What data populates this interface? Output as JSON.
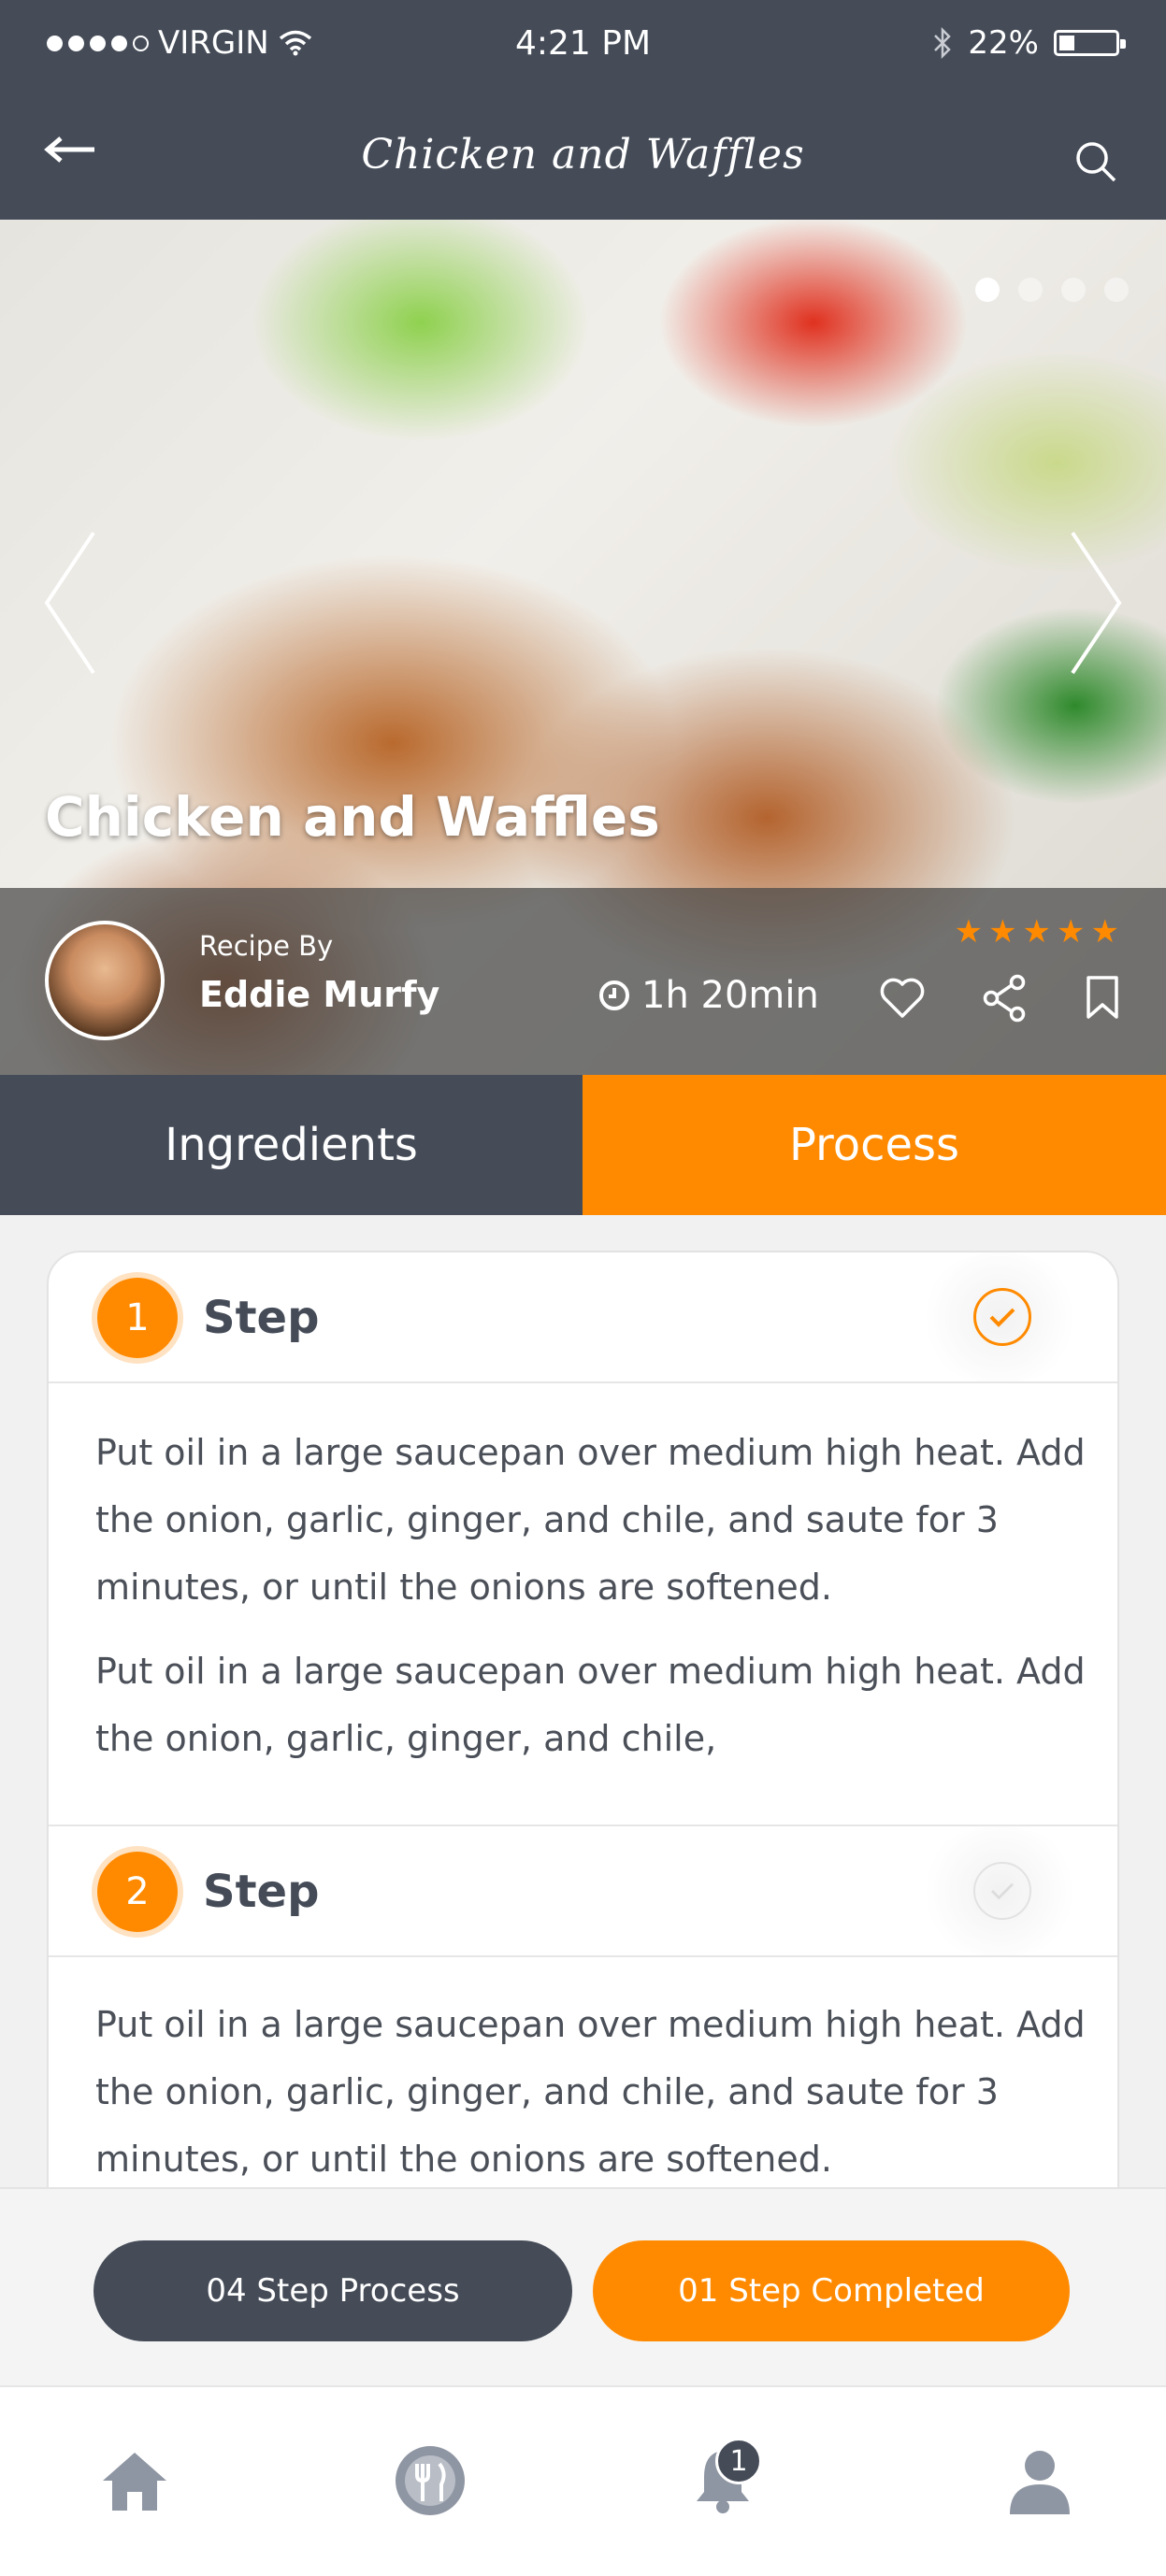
{
  "status_bar": {
    "carrier": "VIRGIN",
    "time": "4:21 PM",
    "battery": "22%"
  },
  "nav": {
    "title": "Chicken and Waffles"
  },
  "hero": {
    "title": "Chicken and Waffles",
    "recipe_by_label": "Recipe By",
    "author": "Eddie Murfy",
    "time": "1h 20min",
    "rating": 5,
    "slide_count": 4,
    "active_slide": 1
  },
  "tabs": [
    {
      "label": "Ingredients",
      "active": false
    },
    {
      "label": "Process",
      "active": true
    }
  ],
  "steps": [
    {
      "number": "1",
      "label": "Step",
      "completed": true,
      "paragraphs": [
        "Put oil in a large saucepan over medium high heat. Add the onion, garlic, ginger, and chile, and saute for 3 minutes, or until the onions are softened.",
        "Put oil in a large saucepan over medium high heat. Add the onion, garlic, ginger, and chile,"
      ]
    },
    {
      "number": "2",
      "label": "Step",
      "completed": false,
      "paragraphs": [
        "Put oil in a large saucepan over medium high heat. Add the onion, garlic, ginger, and chile, and saute for 3 minutes, or until the onions are softened."
      ]
    }
  ],
  "actions": {
    "process_label": "04 Step Process",
    "completed_label": "01 Step Completed"
  },
  "tabbar": {
    "items": [
      "home-icon",
      "recipes-icon",
      "notifications-icon",
      "profile-icon"
    ],
    "notification_count": "1"
  },
  "colors": {
    "dark": "#454c58",
    "accent": "#ff8a00"
  }
}
